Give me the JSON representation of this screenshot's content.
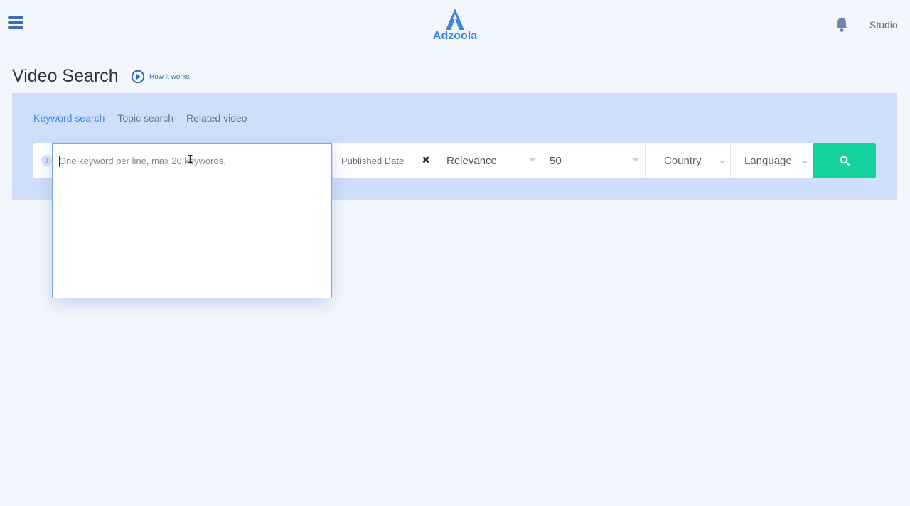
{
  "header": {
    "logo_text": "Adzoola",
    "studio_label": "Studio",
    "menu_icon": "hamburger-icon",
    "notification_icon": "bell-icon"
  },
  "title": {
    "text": "Video Search",
    "how_it_works": "How it works"
  },
  "tabs": [
    {
      "label": "Keyword search",
      "active": true
    },
    {
      "label": "Topic search",
      "active": false
    },
    {
      "label": "Related video",
      "active": false
    }
  ],
  "search": {
    "keyword_count": "0",
    "keyword_placeholder": "One keyword per line, max 20 keywords.",
    "published_date": "Published Date",
    "order": "Relevance",
    "max_results": "50",
    "country": "Country",
    "language": "Language"
  },
  "colors": {
    "accent": "#3a86e6",
    "panel": "#cfdefa",
    "search_button": "#14d39a",
    "background": "#f3f7fd"
  }
}
